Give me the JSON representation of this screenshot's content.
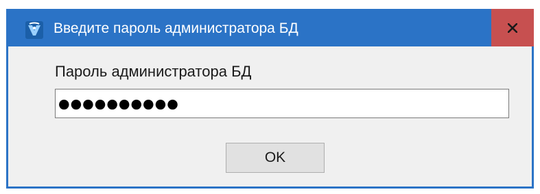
{
  "window": {
    "title": "Введите пароль администратора БД",
    "icon": "application-icon",
    "close_icon": "close-icon"
  },
  "form": {
    "label": "Пароль администратора БД",
    "password_value": "●●●●●●●●●●",
    "ok_label": "OK"
  },
  "colors": {
    "titlebar": "#2b73c6",
    "close_button": "#c75050",
    "client_background": "#f0f0f0",
    "button_background": "#e1e1e1"
  }
}
